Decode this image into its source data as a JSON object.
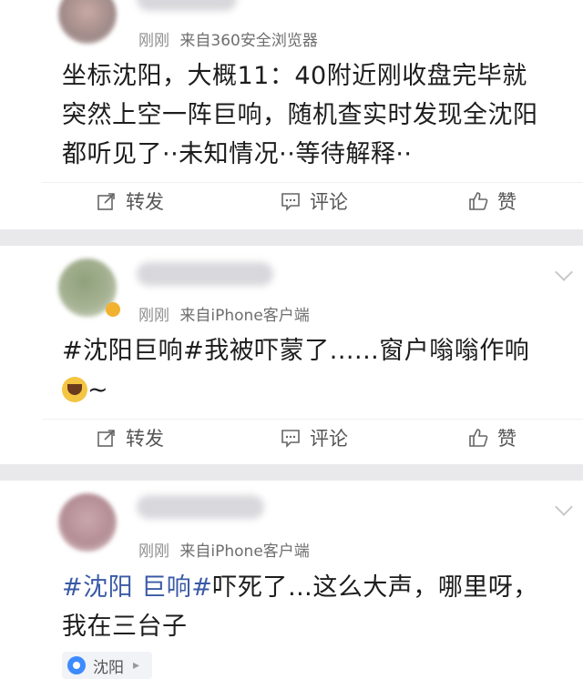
{
  "colors": {
    "separator": "#e9e9ec",
    "topic_link": "#3a5aa6",
    "meta_text": "#8e8e8e",
    "location_pin": "#3d8bff"
  },
  "posts": [
    {
      "time": "刚刚",
      "source": "来自360安全浏览器",
      "text_lines": [
        "坐标沈阳，大概11：40附近刚收盘完毕就",
        "突然上空一阵巨响，随机查实时发现全沈阳",
        "都听见了··未知情况··等待解释··"
      ],
      "actions": {
        "repost": "转发",
        "comment": "评论",
        "like": "赞"
      }
    },
    {
      "time": "刚刚",
      "source": "来自iPhone客户端",
      "text_line1": "#沈阳巨响#我被吓蒙了......窗户嗡嗡作响",
      "text_line2_suffix": "~",
      "emoji_icon": "laughing-crying-emoji",
      "actions": {
        "repost": "转发",
        "comment": "评论",
        "like": "赞"
      }
    },
    {
      "time": "刚刚",
      "source": "来自iPhone客户端",
      "topic": "#沈阳 巨响#",
      "text_after_topic": "吓死了…这么大声，哪里呀，",
      "text_line2": "我在三台子",
      "location": "沈阳",
      "location_arrow": "▸"
    }
  ]
}
